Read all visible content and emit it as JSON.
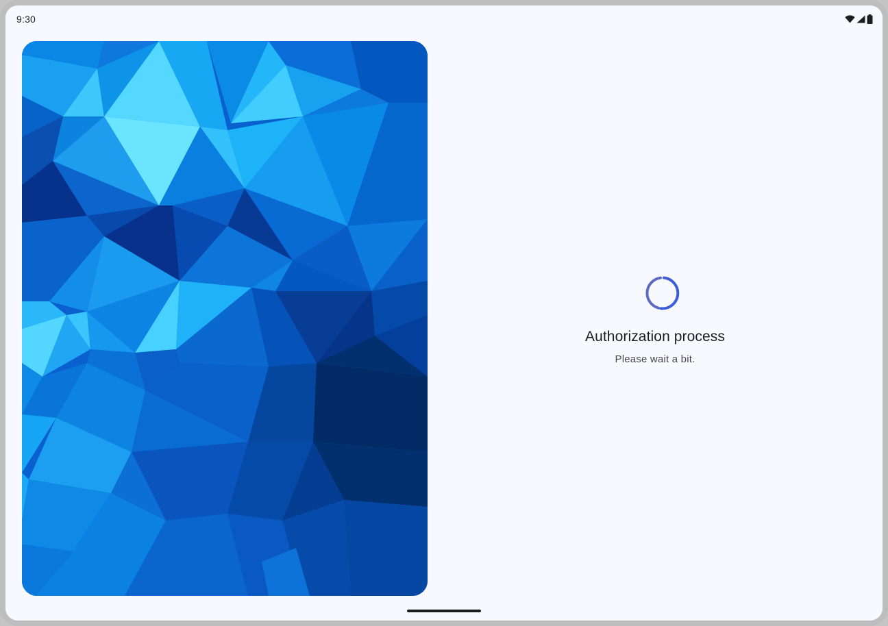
{
  "status_bar": {
    "time": "9:30",
    "icons": [
      "wifi-icon",
      "cellular-signal-icon",
      "battery-icon"
    ]
  },
  "hero": {
    "image": "blue-polygon-illustration"
  },
  "loading": {
    "title": "Authorization process",
    "subtitle": "Please wait a bit.",
    "spinner_colors": [
      "#5c6bc0",
      "#3b5fd9"
    ]
  },
  "colors": {
    "background": "#f7f9fe",
    "frame": "#bdbdbd",
    "text_primary": "#1c1b1f",
    "text_secondary": "#49454f"
  }
}
